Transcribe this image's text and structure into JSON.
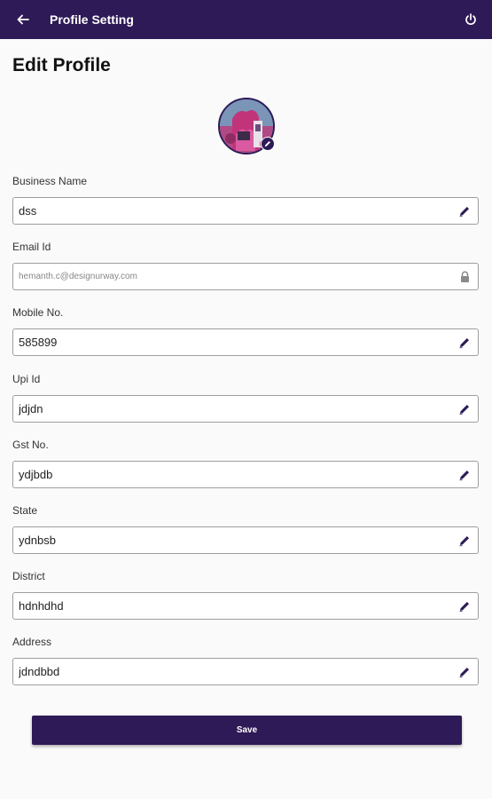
{
  "header": {
    "title": "Profile Setting",
    "back_icon": "arrow-left-icon",
    "power_icon": "power-icon"
  },
  "page": {
    "title": "Edit Profile"
  },
  "avatar": {
    "edit_icon": "pencil-icon"
  },
  "fields": [
    {
      "label": "Business Name",
      "value": "dss",
      "placeholder": "",
      "icon": "pencil-icon",
      "editable": true
    },
    {
      "label": "Email Id",
      "value": "hemanth.c@designurway.com",
      "placeholder": "",
      "icon": "lock-icon",
      "editable": false
    },
    {
      "label": "Mobile No.",
      "value": "585899",
      "placeholder": "",
      "icon": "pencil-icon",
      "editable": true
    },
    {
      "label": "Upi Id",
      "value": "jdjdn",
      "placeholder": "",
      "icon": "pencil-icon",
      "editable": true
    },
    {
      "label": "Gst No.",
      "value": "ydjbdb",
      "placeholder": "",
      "icon": "pencil-icon",
      "editable": true
    },
    {
      "label": "State",
      "value": "ydnbsb",
      "placeholder": "",
      "icon": "pencil-icon",
      "editable": true
    },
    {
      "label": "District",
      "value": "hdnhdhd",
      "placeholder": "",
      "icon": "pencil-icon",
      "editable": true
    },
    {
      "label": "Address",
      "value": "jdndbbd",
      "placeholder": "",
      "icon": "pencil-icon",
      "editable": true
    }
  ],
  "save_button": {
    "label": "Save"
  },
  "colors": {
    "primary": "#2e1a57",
    "background": "#fafafa",
    "border": "#9e9e9e"
  }
}
